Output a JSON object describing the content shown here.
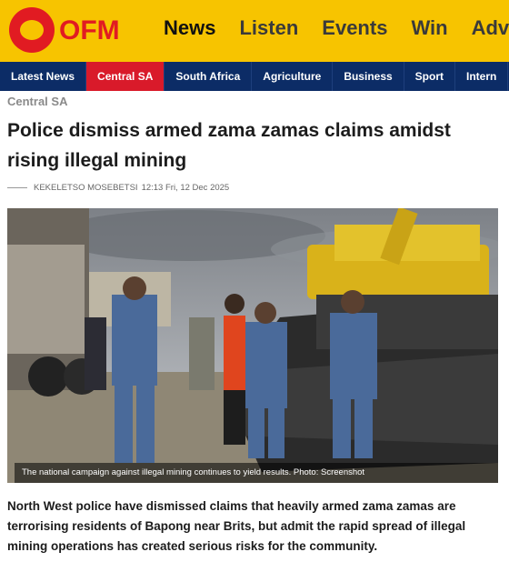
{
  "brand": {
    "logo_text": "OFM",
    "accent_color": "#f7c400",
    "logo_red": "#e11b22"
  },
  "top_nav": [
    {
      "label": "News",
      "active": true
    },
    {
      "label": "Listen",
      "active": false
    },
    {
      "label": "Events",
      "active": false
    },
    {
      "label": "Win",
      "active": false
    },
    {
      "label": "Adv",
      "active": false
    }
  ],
  "sub_nav": [
    {
      "label": "Latest News",
      "active": false
    },
    {
      "label": "Central SA",
      "active": true
    },
    {
      "label": "South Africa",
      "active": false
    },
    {
      "label": "Agriculture",
      "active": false
    },
    {
      "label": "Business",
      "active": false
    },
    {
      "label": "Sport",
      "active": false
    },
    {
      "label": "Intern",
      "active": false
    }
  ],
  "article": {
    "category": "Central SA",
    "title": "Police dismiss armed zama zamas claims amidst rising illegal mining",
    "author": "KEKELETSO MOSEBETSI",
    "date": "12:13 Fri, 12 Dec 2025",
    "image_caption": "The national campaign against illegal mining continues to yield results. Photo: Screenshot",
    "lede": "North West police have dismissed claims that heavily armed zama zamas are terrorising residents of Bapong near Brits, but admit the rapid spread of illegal mining operations has created serious risks for the community."
  }
}
